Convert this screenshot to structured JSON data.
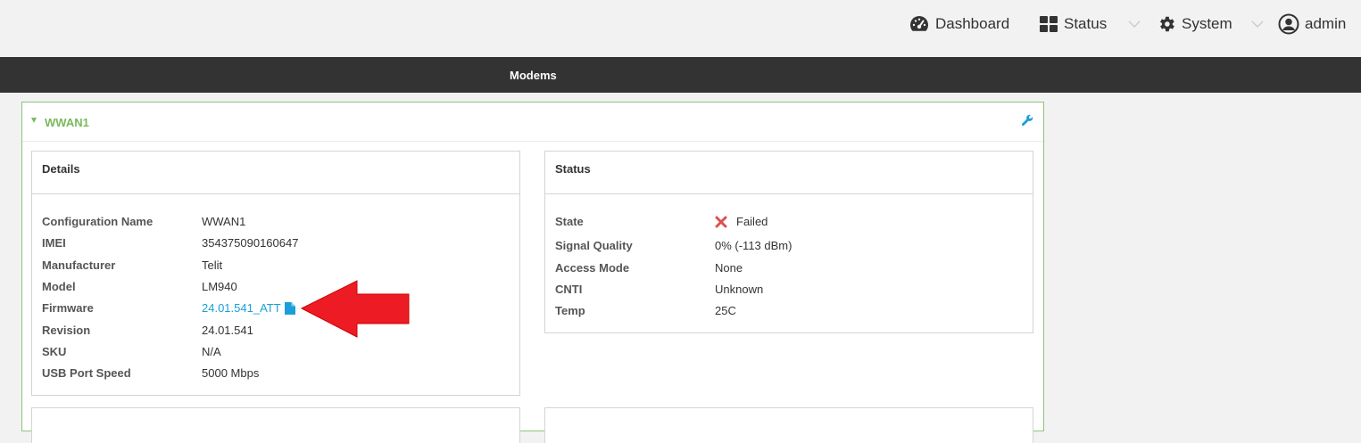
{
  "nav": {
    "dashboard": "Dashboard",
    "status": "Status",
    "system": "System",
    "user": "admin"
  },
  "subnav": {
    "tab": "Modems"
  },
  "panel": {
    "title": "WWAN1",
    "details": {
      "heading": "Details",
      "rows": [
        {
          "label": "Configuration Name",
          "value": "WWAN1"
        },
        {
          "label": "IMEI",
          "value": "354375090160647"
        },
        {
          "label": "Manufacturer",
          "value": "Telit"
        },
        {
          "label": "Model",
          "value": "LM940"
        },
        {
          "label": "Firmware",
          "value": "24.01.541_ATT"
        },
        {
          "label": "Revision",
          "value": "24.01.541"
        },
        {
          "label": "SKU",
          "value": "N/A"
        },
        {
          "label": "USB Port Speed",
          "value": "5000 Mbps"
        }
      ]
    },
    "status": {
      "heading": "Status",
      "rows": [
        {
          "label": "State",
          "value": "Failed"
        },
        {
          "label": "Signal Quality",
          "value": "0% (-113 dBm)"
        },
        {
          "label": "Access Mode",
          "value": "None"
        },
        {
          "label": "CNTI",
          "value": "Unknown"
        },
        {
          "label": "Temp",
          "value": "25C"
        }
      ]
    }
  },
  "colors": {
    "accent_green": "#7ab85e",
    "link_blue": "#1a9fd8",
    "error_red": "#d9534f",
    "annotation_red": "#ed1c24",
    "dark_bar": "#333333"
  },
  "icons": {
    "dashboard": "speedometer-icon",
    "status": "grid-icon",
    "system": "gear-icon",
    "user": "user-circle-icon",
    "configure": "wrench-icon",
    "firmware_file": "file-icon",
    "state_failed": "x-icon"
  }
}
